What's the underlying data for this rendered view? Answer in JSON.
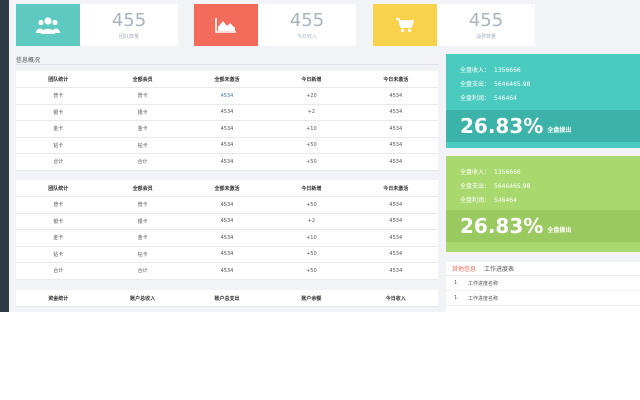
{
  "stats": [
    {
      "value": "455",
      "label": "团队数量",
      "color": "#5ec9c1",
      "icon": "users-icon"
    },
    {
      "value": "455",
      "label": "今日收入",
      "color": "#f26b5b",
      "icon": "area-chart-icon"
    },
    {
      "value": "455",
      "label": "消费数量",
      "color": "#f8d24a",
      "icon": "cart-icon"
    }
  ],
  "section_title": "信息概况",
  "team_table": {
    "headers": [
      "团队统计",
      "全部会员",
      "全部未激活",
      "今日新增",
      "今日未激活"
    ],
    "rows": [
      [
        "普卡",
        "普卡",
        "4534",
        "+20",
        "4534"
      ],
      [
        "银卡",
        "银卡",
        "4534",
        "+2",
        "4534"
      ],
      [
        "金卡",
        "金卡",
        "4534",
        "+10",
        "4534"
      ],
      [
        "钻卡",
        "钻卡",
        "4534",
        "+50",
        "4534"
      ],
      [
        "合计",
        "合计",
        "4534",
        "+50",
        "4534"
      ]
    ]
  },
  "team_table2": {
    "headers": [
      "团队统计",
      "全部会员",
      "全部未激活",
      "今日新增",
      "今日未激活"
    ],
    "rows": [
      [
        "普卡",
        "普卡",
        "4534",
        "+50",
        "4534"
      ],
      [
        "银卡",
        "银卡",
        "4534",
        "+2",
        "4534"
      ],
      [
        "金卡",
        "金卡",
        "4534",
        "+10",
        "4534"
      ],
      [
        "钻卡",
        "钻卡",
        "4534",
        "+50",
        "4534"
      ],
      [
        "合计",
        "合计",
        "4534",
        "+50",
        "4534"
      ]
    ]
  },
  "fund_table": {
    "headers": [
      "资金统计",
      "账户总收入",
      "账户总支出",
      "账户余额",
      "今日收入"
    ]
  },
  "cards": [
    {
      "income_label": "全盘收入：",
      "income": "1356666",
      "expense_label": "全盘支出：",
      "expense": "5646465.98",
      "profit_label": "全盘利润：",
      "profit": "546464",
      "percent": "26.83%",
      "percent_label": "全盘拨出",
      "color": "#4bcbbf",
      "band_color": "#3bb3a8"
    },
    {
      "income_label": "全盘收入：",
      "income": "1356666",
      "expense_label": "全盘支出：",
      "expense": "5646465.98",
      "profit_label": "全盘利润：",
      "profit": "546464",
      "percent": "26.83%",
      "percent_label": "全盘拨出",
      "color": "#a9d86e",
      "band_color": "#99c95f"
    }
  ],
  "tabs": {
    "items": [
      "其他信息",
      "工作进度表"
    ],
    "rows": [
      {
        "n": "1",
        "text": "工作进度名称"
      },
      {
        "n": "1",
        "text": "工作进度名称"
      }
    ]
  }
}
